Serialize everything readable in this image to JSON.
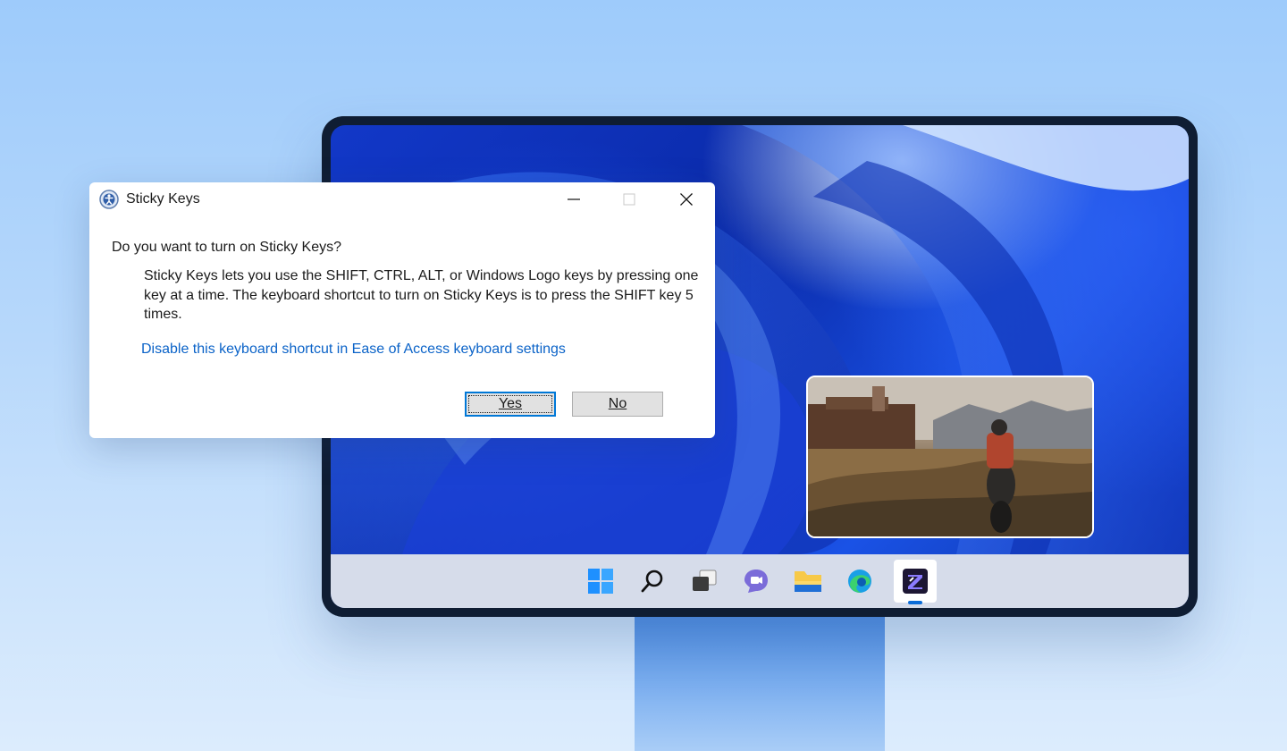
{
  "dialog": {
    "title": "Sticky Keys",
    "question": "Do you want to turn on Sticky Keys?",
    "description": "Sticky Keys lets you use the SHIFT, CTRL, ALT, or Windows Logo keys by pressing one key at a time. The keyboard shortcut to turn on Sticky Keys is to press the SHIFT key 5 times.",
    "link": "Disable this keyboard shortcut in Ease of Access keyboard settings",
    "yes_label": "Yes",
    "no_label": "No",
    "title_icon": "ease-of-access-icon",
    "window_controls": [
      "minimize-icon",
      "maximize-icon",
      "close-icon"
    ]
  },
  "taskbar": {
    "icons": [
      "windows-start-icon",
      "search-icon",
      "task-view-icon",
      "teams-chat-icon",
      "file-explorer-icon",
      "edge-browser-icon",
      "app-icon"
    ],
    "active_index": 6,
    "accent": "#0a6cd8"
  },
  "preview": {
    "description_icon": "game-thumbnail"
  },
  "colors": {
    "background_top": "#9ecbfb",
    "link": "#0b63c8",
    "default_button_border": "#0078d7",
    "monitor_frame": "#0f1d33"
  }
}
